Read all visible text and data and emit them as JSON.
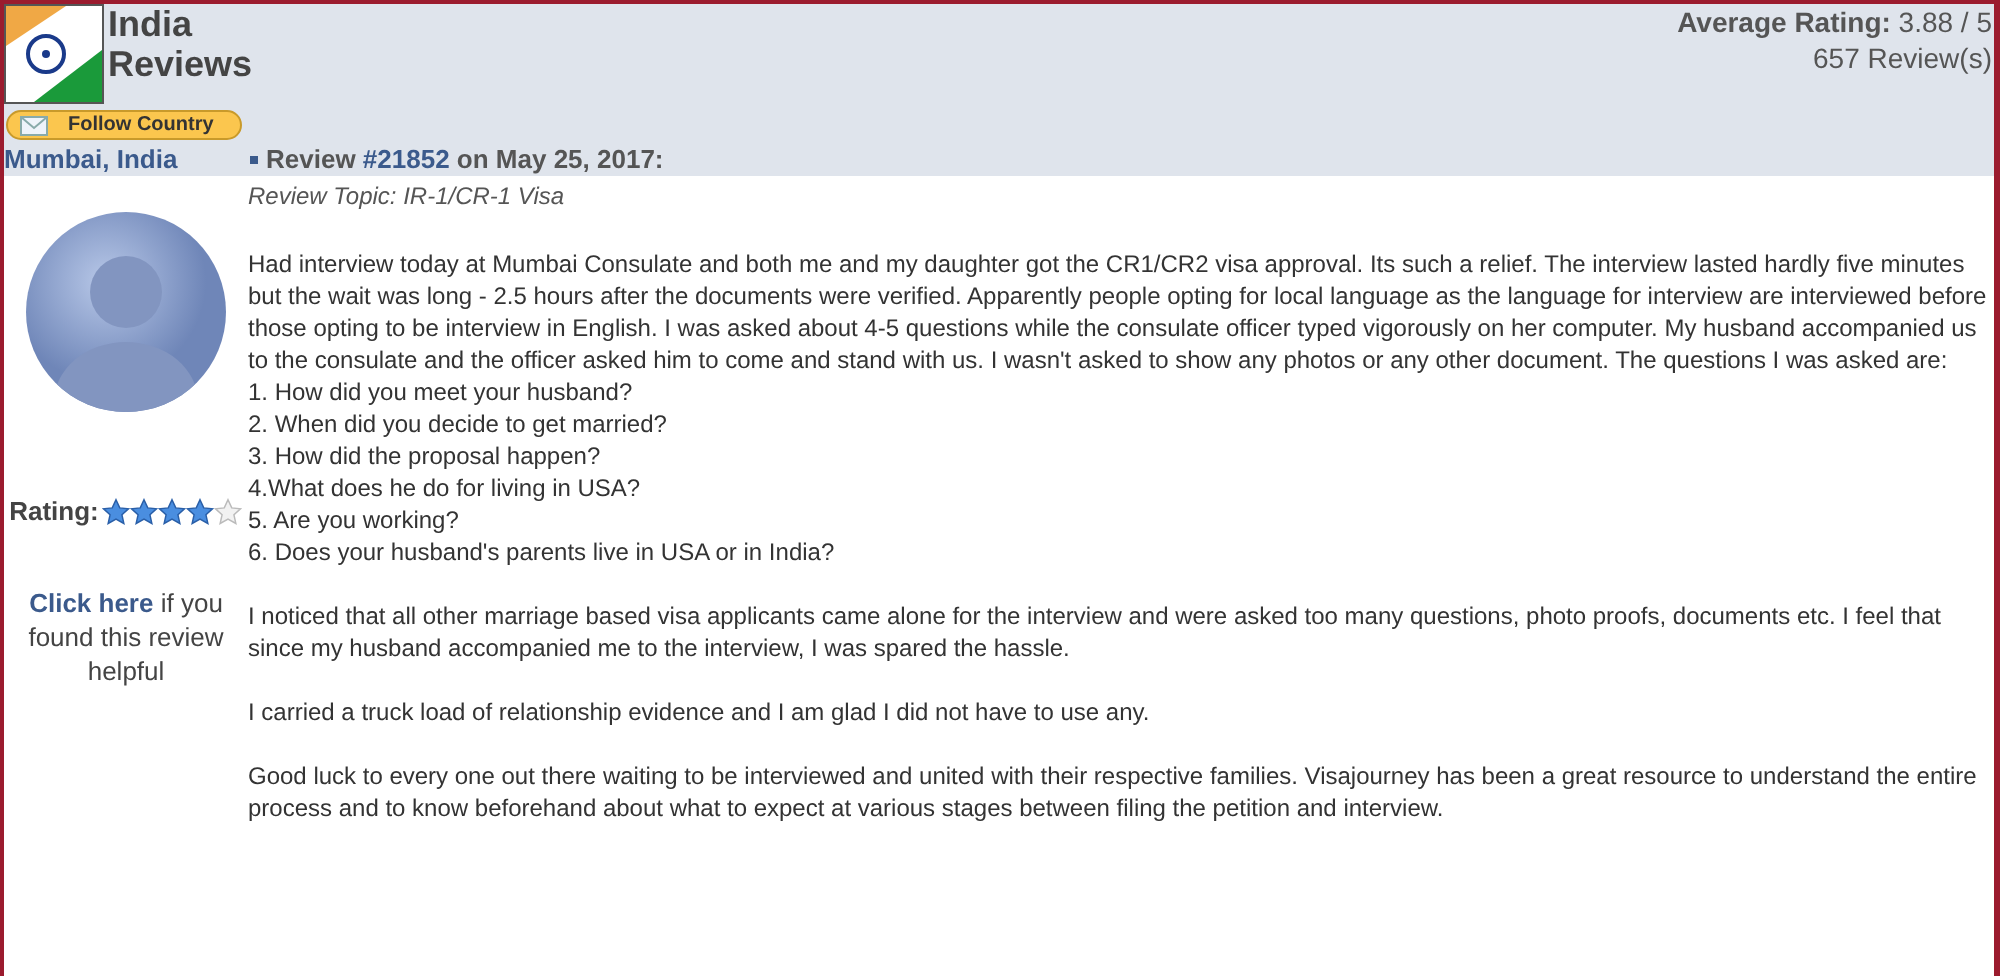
{
  "header": {
    "title_line1": "India",
    "title_line2": "Reviews",
    "follow_button": "Follow Country",
    "average_label": "Average Rating:",
    "average_value": "3.88 / 5",
    "review_count": "657 Review(s)"
  },
  "review": {
    "location": "Mumbai, India",
    "heading_prefix": "Review",
    "number": "#21852",
    "date_text": "on May 25, 2017:",
    "topic": "Review Topic: IR-1/CR-1 Visa",
    "rating_label": "Rating:",
    "stars": 4,
    "helpful_link": "Click here",
    "helpful_text": "if you found this review helpful",
    "body": [
      {
        "kind": "paragraph",
        "text": "Had interview today at Mumbai Consulate and both me and my daughter got the CR1/CR2 visa approval. Its such a relief. The interview lasted hardly five minutes but the wait was long - 2.5 hours after the documents were verified. Apparently people opting for local language as the language for interview are interviewed before those opting to be interview in English. I was asked about 4-5 questions while the consulate officer typed vigorously on her computer. My husband accompanied us to the consulate and the officer asked him to come and stand with us.  I wasn't asked to show any photos or any other document. The questions I was asked are:"
      },
      {
        "kind": "line",
        "text": "1. How did you meet your husband?"
      },
      {
        "kind": "line",
        "text": "2. When did you decide to get married?"
      },
      {
        "kind": "line",
        "text": "3. How did the proposal happen?"
      },
      {
        "kind": "line",
        "text": "4.What does he do for living in USA?"
      },
      {
        "kind": "line",
        "text": "5. Are you working?"
      },
      {
        "kind": "line",
        "text": "6. Does your husband's parents live in USA or in India?"
      },
      {
        "kind": "gap"
      },
      {
        "kind": "paragraph",
        "text": "I noticed that all other marriage based visa applicants came alone for the interview and were asked too many questions, photo proofs, documents etc. I feel that since my husband accompanied me to the interview, I was spared the hassle."
      },
      {
        "kind": "gap"
      },
      {
        "kind": "paragraph",
        "text": "I carried a truck load of relationship evidence and I am glad I did not have to use any."
      },
      {
        "kind": "gap"
      },
      {
        "kind": "paragraph",
        "text": "Good luck to every one out there waiting to be interviewed and united with their respective families. Visajourney has been a great resource to understand the entire process and to know beforehand about what to expect at various stages between filing the petition and interview."
      }
    ]
  }
}
